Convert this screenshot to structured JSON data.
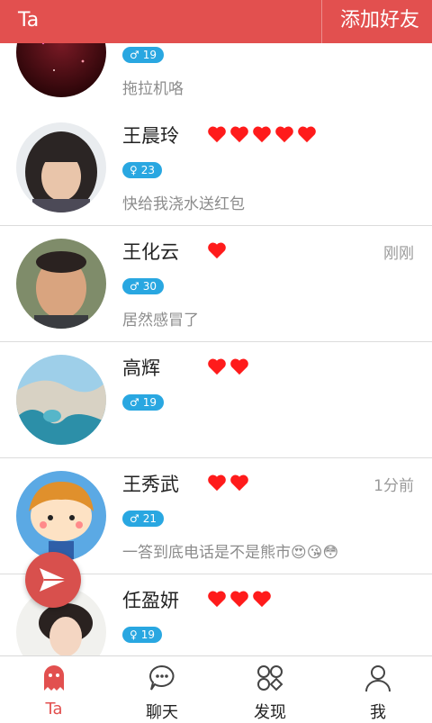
{
  "header": {
    "title": "Ta",
    "action": "添加好友"
  },
  "colors": {
    "accent": "#e2504f",
    "badge": "#29a7e1",
    "heart": "#ff1b1b"
  },
  "contacts": [
    {
      "name": "",
      "hearts": 0,
      "time": "",
      "gender": "♂",
      "age": "19",
      "status": "拖拉机咯"
    },
    {
      "name": "王晨玲",
      "hearts": 5,
      "time": "",
      "gender": "♀",
      "age": "23",
      "status": "快给我浇水送红包"
    },
    {
      "name": "王化云",
      "hearts": 1,
      "time": "刚刚",
      "gender": "♂",
      "age": "30",
      "status": "居然感冒了"
    },
    {
      "name": "高辉",
      "hearts": 2,
      "time": "",
      "gender": "♂",
      "age": "19",
      "status": ""
    },
    {
      "name": "王秀武",
      "hearts": 2,
      "time": "1分前",
      "gender": "♂",
      "age": "21",
      "status": "一答到底电话是不是熊市😍😘😳"
    },
    {
      "name": "任盈妍",
      "hearts": 3,
      "time": "",
      "gender": "♀",
      "age": "19",
      "status": ""
    }
  ],
  "tabs": [
    {
      "label": "Ta",
      "icon": "ghost-icon",
      "active": true
    },
    {
      "label": "聊天",
      "icon": "chat-bubble-icon",
      "active": false
    },
    {
      "label": "发现",
      "icon": "discover-icon",
      "active": false
    },
    {
      "label": "我",
      "icon": "person-icon",
      "active": false
    }
  ],
  "fab": {
    "icon": "send-icon"
  }
}
